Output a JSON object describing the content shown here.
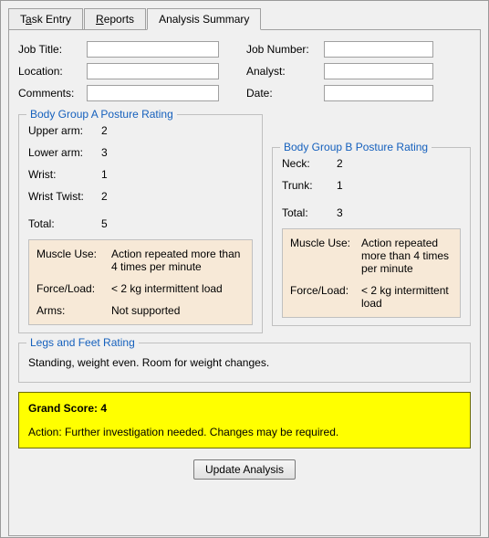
{
  "tabs": {
    "task_entry_pre": "T",
    "task_entry_mn": "a",
    "task_entry_post": "sk Entry",
    "reports_pre": "",
    "reports_mn": "R",
    "reports_post": "eports",
    "analysis_summary": "Analysis Summary"
  },
  "form": {
    "job_title_label": "Job Title:",
    "job_title_value": "",
    "location_label": "Location:",
    "location_value": "",
    "comments_label": "Comments:",
    "comments_value": "",
    "job_number_label": "Job Number:",
    "job_number_value": "",
    "analyst_label": "Analyst:",
    "analyst_value": "",
    "date_label": "Date:",
    "date_value": ""
  },
  "groupA": {
    "legend": "Body Group A Posture Rating",
    "upper_arm_label": "Upper arm:",
    "upper_arm_value": "2",
    "lower_arm_label": "Lower arm:",
    "lower_arm_value": "3",
    "wrist_label": "Wrist:",
    "wrist_value": "1",
    "wrist_twist_label": "Wrist Twist:",
    "wrist_twist_value": "2",
    "total_label": "Total:",
    "total_value": "5",
    "muscle_use_label": "Muscle Use:",
    "muscle_use_value": "Action repeated more than 4 times per minute",
    "force_load_label": "Force/Load:",
    "force_load_value": "< 2 kg intermittent load",
    "arms_label": "Arms:",
    "arms_value": "Not supported"
  },
  "groupB": {
    "legend": "Body Group B Posture Rating",
    "neck_label": "Neck:",
    "neck_value": "2",
    "trunk_label": "Trunk:",
    "trunk_value": "1",
    "total_label": "Total:",
    "total_value": "3",
    "muscle_use_label": "Muscle Use:",
    "muscle_use_value": "Action repeated more than 4 times per minute",
    "force_load_label": "Force/Load:",
    "force_load_value": "< 2 kg intermittent load"
  },
  "legs": {
    "legend": "Legs and Feet Rating",
    "text": "Standing, weight even.  Room for weight changes."
  },
  "grand": {
    "score_text": "Grand Score:  4",
    "action_text": "Action:  Further investigation needed.  Changes may be required."
  },
  "buttons": {
    "update": "Update Analysis"
  }
}
